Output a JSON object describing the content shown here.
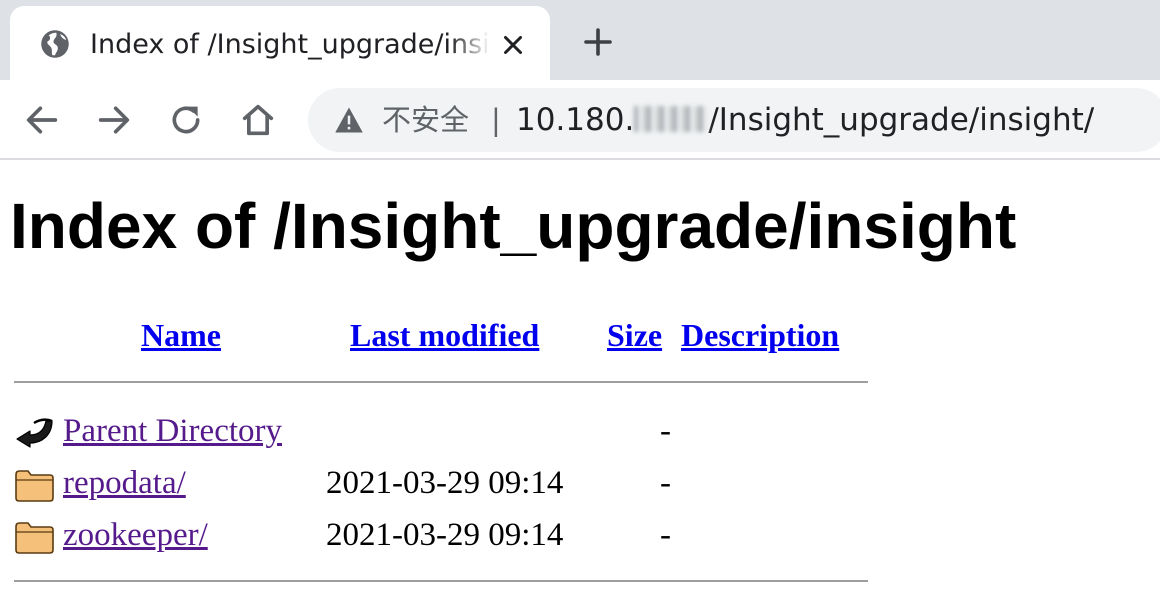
{
  "browser": {
    "tab_title": "Index of /Insight_upgrade/insight/",
    "address_bar": {
      "security_label": "不安全",
      "separator": "|",
      "url_prefix": "10.180.",
      "url_suffix": "/Insight_upgrade/insight/"
    },
    "icons": {
      "favicon": "globe-icon",
      "close": "close-icon",
      "new_tab": "plus-icon",
      "back": "back-arrow-icon",
      "forward": "forward-arrow-icon",
      "reload": "reload-icon",
      "home": "home-icon",
      "security": "warning-triangle-icon"
    }
  },
  "page": {
    "title": "Index of /Insight_upgrade/insight",
    "columns": {
      "name": "Name",
      "last_modified": "Last modified",
      "size": "Size",
      "description": "Description"
    },
    "rows": [
      {
        "icon": "parent-directory-icon",
        "name": "Parent Directory",
        "last_modified": "",
        "size": "-"
      },
      {
        "icon": "folder-icon",
        "name": "repodata/",
        "last_modified": "2021-03-29 09:14",
        "size": "-"
      },
      {
        "icon": "folder-icon",
        "name": "zookeeper/",
        "last_modified": "2021-03-29 09:14",
        "size": "-"
      }
    ]
  },
  "colors": {
    "link": "#0000ee",
    "visited_link": "#551a8b",
    "tabstrip_bg": "#dee1e6",
    "omnibox_bg": "#f1f3f4"
  }
}
